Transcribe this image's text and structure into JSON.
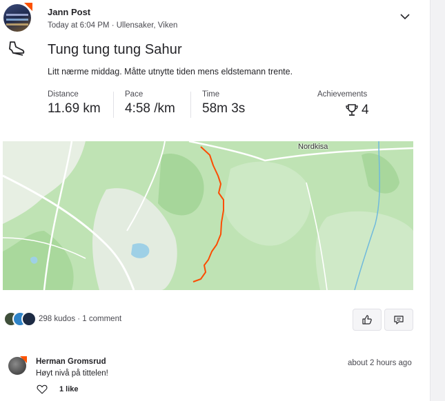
{
  "activity": {
    "athlete_name": "Jann Post",
    "meta": "Today at 6:04 PM · Ullensaker, Viken",
    "title": "Tung tung tung Sahur",
    "description": "Litt nærme middag. Måtte utnytte tiden mens eldstemann trente.",
    "sport_icon": "run-shoe-icon",
    "menu_icon": "chevron-down-icon"
  },
  "stats": [
    {
      "label": "Distance",
      "value": "11.69 km"
    },
    {
      "label": "Pace",
      "value": "4:58 /km"
    },
    {
      "label": "Time",
      "value": "58m 3s"
    }
  ],
  "achievements": {
    "label": "Achievements",
    "value": "4",
    "icon": "trophy-icon"
  },
  "map": {
    "place_label": "Nordkisa",
    "route_color": "#fc4c02"
  },
  "social": {
    "kudos_text": "298 kudos · 1 comment",
    "kudos_icon": "thumbs-up-icon",
    "comment_icon": "comment-icon"
  },
  "comments": [
    {
      "author": "Herman Gromsrud",
      "time": "about 2 hours ago",
      "text": "Høyt nivå på tittelen!",
      "likes": "1 like"
    }
  ],
  "colors": {
    "brand": "#fc5200",
    "text": "#242428",
    "muted": "#494950"
  }
}
